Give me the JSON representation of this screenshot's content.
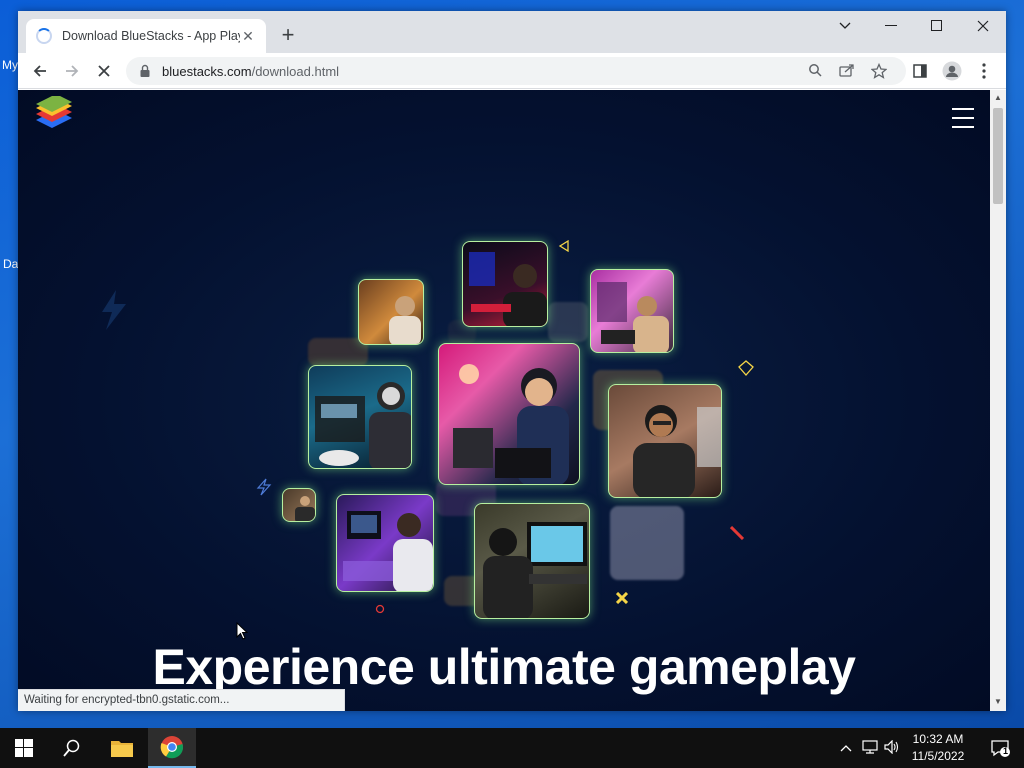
{
  "desktop": {
    "icon_label_1": "My",
    "icon_label_2": "Da"
  },
  "browser": {
    "tab": {
      "title": "Download BlueStacks - App Player"
    },
    "url": {
      "host": "bluestacks.com",
      "path": "/download.html"
    },
    "status_text": "Waiting for encrypted-tbn0.gstatic.com..."
  },
  "page": {
    "headline": "Experience ultimate gameplay",
    "tiles": [
      "gamer-orange-room",
      "gamer-red-setup",
      "gamer-pink-room",
      "gamer-console",
      "gamer-neon-headset",
      "gamer-glasses",
      "gamer-small",
      "gamer-purple-desk",
      "gamer-monitor"
    ]
  },
  "taskbar": {
    "time": "10:32 AM",
    "date": "11/5/2022",
    "notification_count": "1"
  },
  "colors": {
    "page_bg": "#041130",
    "tile_glow": "#b7f0a0",
    "taskbar_bg": "#101010",
    "desktop_bg": "#0b5ed7"
  }
}
